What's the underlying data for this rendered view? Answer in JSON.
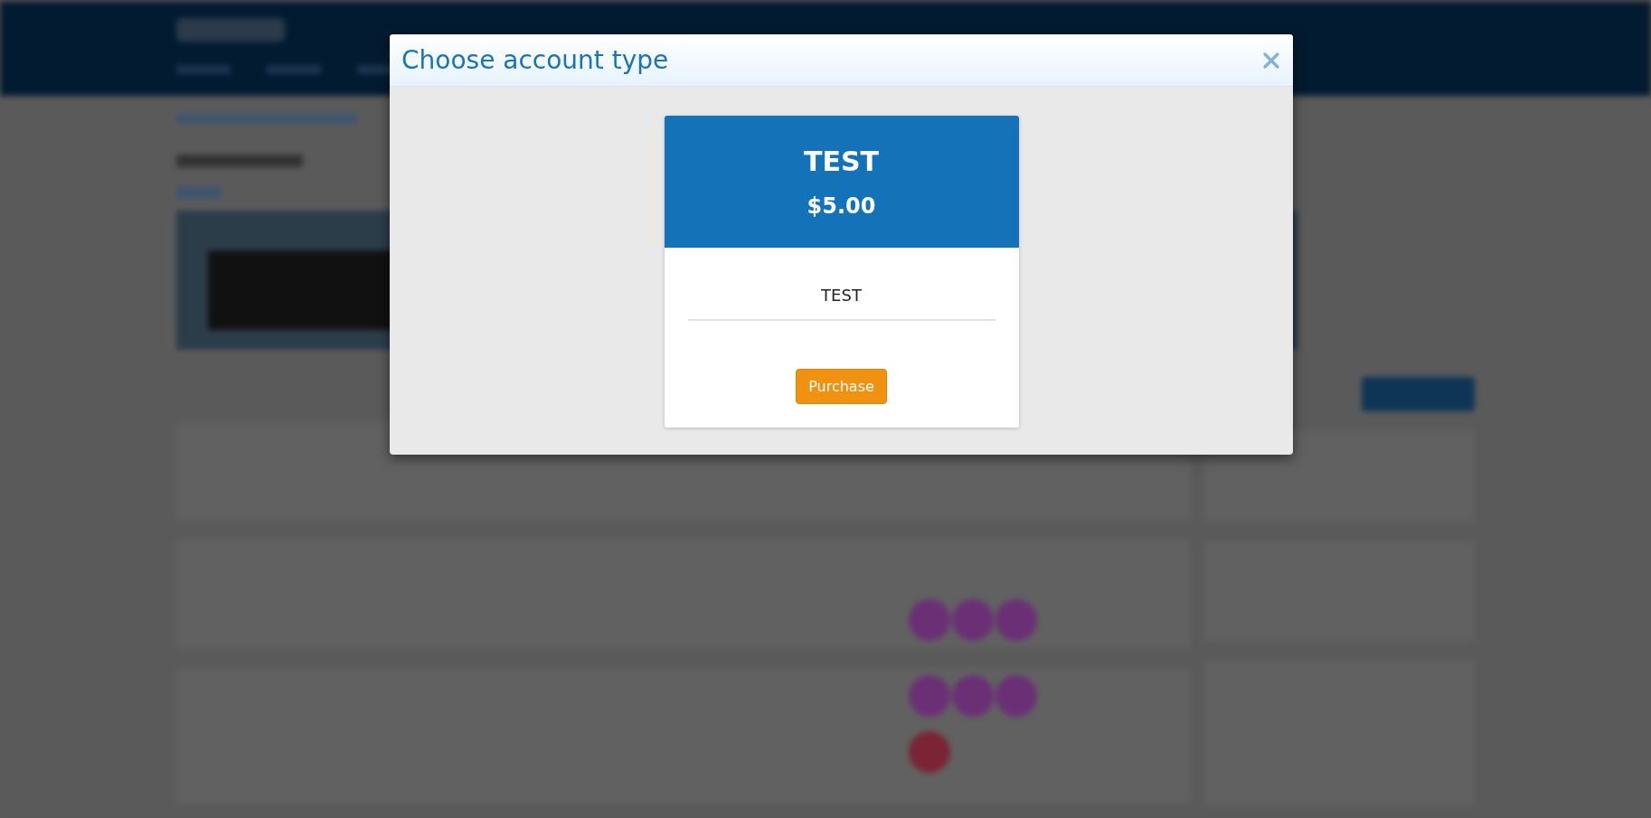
{
  "dialog": {
    "title": "Choose account type"
  },
  "plans": [
    {
      "name": "TEST",
      "price": "$5.00",
      "description": "TEST",
      "button": "Purchase"
    }
  ]
}
